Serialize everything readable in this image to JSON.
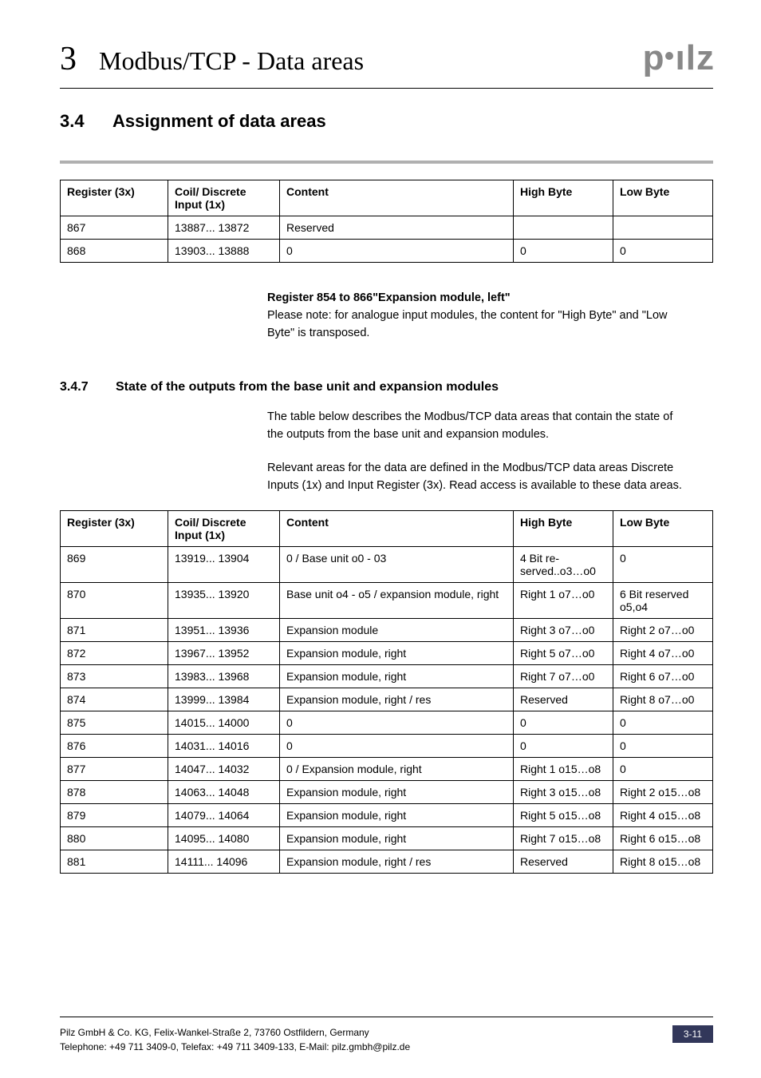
{
  "header": {
    "chapter_num": "3",
    "chapter_title": "Modbus/TCP - Data areas",
    "logo_letters": "pilz"
  },
  "section": {
    "num": "3.4",
    "title": "Assignment of data areas"
  },
  "table1": {
    "headers": {
      "register": "Register (3x)",
      "coil": "Coil/ Discrete Input (1x)",
      "content": "Content",
      "high": "High Byte",
      "low": "Low Byte"
    },
    "rows": [
      {
        "register": "867",
        "coil": "13887... 13872",
        "content": "Reserved",
        "high": "",
        "low": ""
      },
      {
        "register": "868",
        "coil": "13903... 13888",
        "content": "0",
        "high": "0",
        "low": "0"
      }
    ]
  },
  "note": {
    "heading": "Register 854 to 866\"Expansion module, left\"",
    "body": "Please note: for analogue input modules, the content for \"High Byte\" and \"Low Byte\" is transposed."
  },
  "subsection": {
    "num": "3.4.7",
    "title": "State of the outputs from the base unit and expansion modules"
  },
  "para1": "The table below describes the Modbus/TCP data areas that contain the state of the outputs from the base unit and expansion modules.",
  "para2": "Relevant areas for the data are defined in the Modbus/TCP data areas Discrete Inputs (1x) and Input Register (3x). Read access is available to these data areas.",
  "table2": {
    "headers": {
      "register": "Register (3x)",
      "coil": "Coil/ Discrete Input (1x)",
      "content": "Content",
      "high": "High Byte",
      "low": "Low Byte"
    },
    "rows": [
      {
        "register": "869",
        "coil": "13919... 13904",
        "content": "0 / Base unit o0 - 03",
        "high": "4 Bit re-served..o3…o0",
        "low": "0"
      },
      {
        "register": "870",
        "coil": "13935... 13920",
        "content": "Base unit o4 - o5 / expansion module, right",
        "high": "Right 1 o7…o0",
        "low": "6 Bit reserved o5,o4"
      },
      {
        "register": "871",
        "coil": "13951... 13936",
        "content": "Expansion module",
        "high": "Right 3 o7…o0",
        "low": "Right 2 o7…o0"
      },
      {
        "register": "872",
        "coil": "13967... 13952",
        "content": "Expansion module, right",
        "high": "Right 5 o7…o0",
        "low": "Right 4 o7…o0"
      },
      {
        "register": "873",
        "coil": "13983... 13968",
        "content": "Expansion module, right",
        "high": "Right 7 o7…o0",
        "low": "Right 6 o7…o0"
      },
      {
        "register": "874",
        "coil": "13999... 13984",
        "content": "Expansion module, right / res",
        "high": "Reserved",
        "low": "Right 8 o7…o0"
      },
      {
        "register": "875",
        "coil": "14015... 14000",
        "content": "0",
        "high": "0",
        "low": "0"
      },
      {
        "register": "876",
        "coil": "14031... 14016",
        "content": "0",
        "high": "0",
        "low": "0"
      },
      {
        "register": "877",
        "coil": "14047... 14032",
        "content": "0 / Expansion module, right",
        "high": "Right 1 o15…o8",
        "low": "0"
      },
      {
        "register": "878",
        "coil": "14063... 14048",
        "content": "Expansion module, right",
        "high": "Right 3 o15…o8",
        "low": "Right 2 o15…o8"
      },
      {
        "register": "879",
        "coil": "14079... 14064",
        "content": "Expansion module, right",
        "high": "Right 5 o15…o8",
        "low": "Right 4 o15…o8"
      },
      {
        "register": "880",
        "coil": "14095... 14080",
        "content": "Expansion module, right",
        "high": "Right 7 o15…o8",
        "low": "Right 6 o15…o8"
      },
      {
        "register": "881",
        "coil": "14111... 14096",
        "content": "Expansion module, right / res",
        "high": "Reserved",
        "low": "Right 8 o15…o8"
      }
    ]
  },
  "footer": {
    "line1": "Pilz GmbH & Co. KG, Felix-Wankel-Straße 2, 73760 Ostfildern, Germany",
    "line2": "Telephone: +49 711 3409-0, Telefax: +49 711 3409-133, E-Mail: pilz.gmbh@pilz.de",
    "page": "3-11"
  }
}
